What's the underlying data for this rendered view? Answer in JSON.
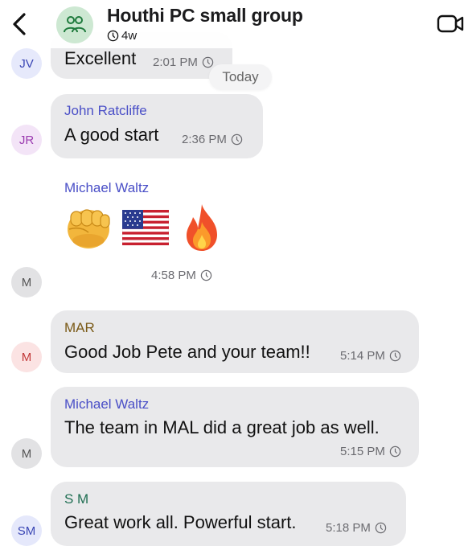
{
  "header": {
    "title": "Houthi PC small group",
    "age": "4w"
  },
  "date_divider": "Today",
  "messages": [
    {
      "avatar": "JV",
      "text": "Excellent",
      "time": "2:01 PM"
    },
    {
      "avatar": "JR",
      "sender": "John Ratcliffe",
      "text": "A good start",
      "time": "2:36 PM"
    },
    {
      "avatar": "M",
      "sender": "Michael Waltz",
      "emojis": [
        "oncoming-fist",
        "us-flag",
        "fire"
      ],
      "time": "4:58 PM"
    },
    {
      "avatar": "M",
      "sender": "MAR",
      "text": "Good Job Pete and your team!!",
      "time": "5:14 PM"
    },
    {
      "avatar": "M",
      "sender": "Michael Waltz",
      "text": "The team in MAL did a great job  as well.",
      "time": "5:15 PM"
    },
    {
      "avatar": "SM",
      "sender": "S M",
      "text": "Great work all. Powerful start.",
      "time": "5:18 PM"
    }
  ],
  "colors": {
    "bubble": "#e9e9eb",
    "sender_blue": "#4a4fc7",
    "sender_mar": "#7a5a17",
    "sender_sm": "#1f6e52",
    "avatar_jv_bg": "#e6e9fb",
    "avatar_jr_bg": "#f3e4f7",
    "avatar_m_bg": "#e2e2e4",
    "avatar_mar_bg": "#fbe3e3",
    "avatar_sm_bg": "#e5e8fb"
  }
}
